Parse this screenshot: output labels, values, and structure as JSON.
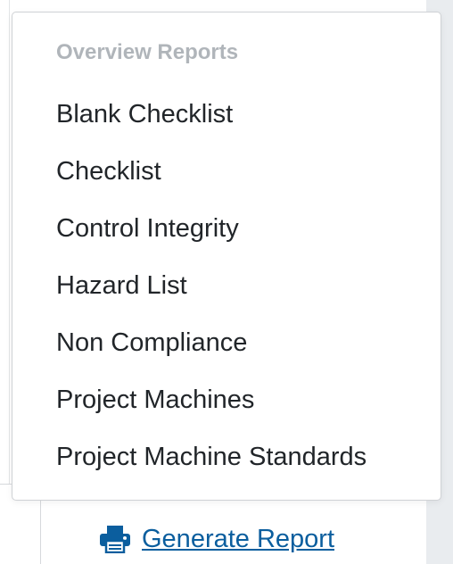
{
  "dropdown": {
    "header": "Overview Reports",
    "items": [
      {
        "label": "Blank Checklist"
      },
      {
        "label": "Checklist"
      },
      {
        "label": "Control Integrity"
      },
      {
        "label": "Hazard List"
      },
      {
        "label": "Non Compliance"
      },
      {
        "label": "Project Machines"
      },
      {
        "label": "Project Machine Standards"
      }
    ]
  },
  "generate": {
    "label": " Generate Report",
    "icon": "printer-icon",
    "color": "#0b5e9e"
  }
}
